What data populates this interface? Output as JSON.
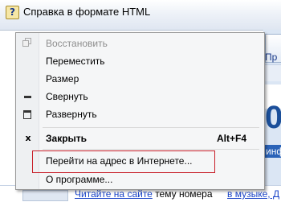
{
  "window": {
    "title": "Справка в формате HTML",
    "icon": "help-book-icon"
  },
  "menu": {
    "restore": {
      "label": "Восстановить",
      "icon": "restore-icon",
      "enabled": false
    },
    "move": {
      "label": "Переместить"
    },
    "size": {
      "label": "Размер"
    },
    "minimize": {
      "label": "Свернуть",
      "icon": "minimize-icon"
    },
    "maximize": {
      "label": "Развернуть",
      "icon": "maximize-icon"
    },
    "close": {
      "label": "Закрыть",
      "shortcut": "Alt+F4",
      "icon": "close-icon"
    },
    "goto_url": {
      "label": "Перейти на адрес в Интернете...",
      "highlighted": true
    },
    "about": {
      "label": "О программе..."
    }
  },
  "background": {
    "tab_text": "Пр",
    "big_digit": "0",
    "blue_bar_text": "инф",
    "link1_link": "Читайте на сайте",
    "link1_text": " тему номера",
    "link2_link": "в музыке, Д"
  },
  "colors": {
    "highlight_border": "#c8202a",
    "link": "#1a44c8",
    "accent_blue": "#2a63b8"
  }
}
